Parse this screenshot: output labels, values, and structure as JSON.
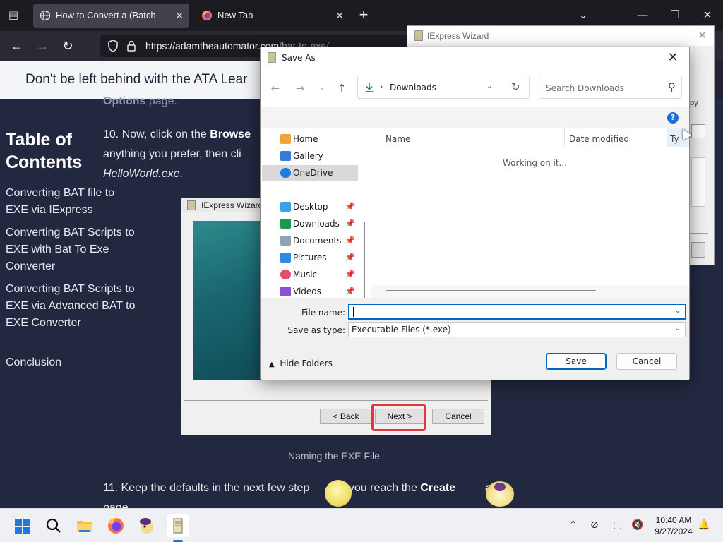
{
  "browser": {
    "tabs": [
      {
        "title": "How to Convert a (Batch File) B",
        "active": true
      },
      {
        "title": "New Tab",
        "active": false
      }
    ],
    "url_main": "https://adamtheautomator.com",
    "url_path": "/bat-to-exe/"
  },
  "page": {
    "banner_text": "Don't be left behind with the ATA Lear",
    "toc_heading": "Table of Contents",
    "toc_items": [
      "Converting BAT file to EXE via IExpress",
      "Converting BAT Scripts to EXE with Bat To Exe Converter",
      "Converting BAT Scripts to EXE via Advanced BAT to EXE Converter",
      "Conclusion"
    ],
    "step_prev_bold": "Options",
    "step_prev_rest": " page.",
    "step10_prefix": "10. Now, click on the ",
    "step10_bold": "Browse",
    "step10_line2": "anything you prefer, then cli",
    "step10_line3": "HelloWorld.exe",
    "step10_line3_end": ".",
    "caption": "Naming the EXE File",
    "step11_start": "11. Keep the defaults in the next few step",
    "step11_mid": "il you reach the ",
    "step11_bold_a": "Create",
    "step11_bold_b": "age",
    "step11_line2": "page."
  },
  "wizard_screenshot": {
    "title": "IExpress Wizard",
    "back_label": "< Back",
    "next_label": "Next >",
    "cancel_label": "Cancel"
  },
  "wizard_window": {
    "title": "IExpress Wizard",
    "frag_text": "py"
  },
  "save_dialog": {
    "title": "Save As",
    "path_crumb": "Downloads",
    "search_placeholder": "Search Downloads",
    "nav_items": [
      {
        "label": "Home",
        "pinned": false,
        "selected": false
      },
      {
        "label": "Gallery",
        "pinned": false,
        "selected": false
      },
      {
        "label": "OneDrive",
        "pinned": false,
        "selected": true
      },
      {
        "label": "Desktop",
        "pinned": true,
        "selected": false
      },
      {
        "label": "Downloads",
        "pinned": true,
        "selected": false
      },
      {
        "label": "Documents",
        "pinned": true,
        "selected": false
      },
      {
        "label": "Pictures",
        "pinned": true,
        "selected": false
      },
      {
        "label": "Music",
        "pinned": true,
        "selected": false
      },
      {
        "label": "Videos",
        "pinned": true,
        "selected": false
      }
    ],
    "columns": [
      "Name",
      "Date modified",
      "Ty"
    ],
    "status_text": "Working on it...",
    "file_name_label": "File name:",
    "file_name_value": "",
    "save_type_label": "Save as type:",
    "save_type_value": "Executable Files (*.exe)",
    "hide_folders_label": "Hide Folders",
    "save_label": "Save",
    "cancel_label": "Cancel"
  },
  "taskbar": {
    "time": "10:40 AM",
    "date": "9/27/2024"
  },
  "colors": {
    "page_bg": "#222840",
    "accent_blue": "#0067c0",
    "highlight_red": "#e0363d"
  }
}
